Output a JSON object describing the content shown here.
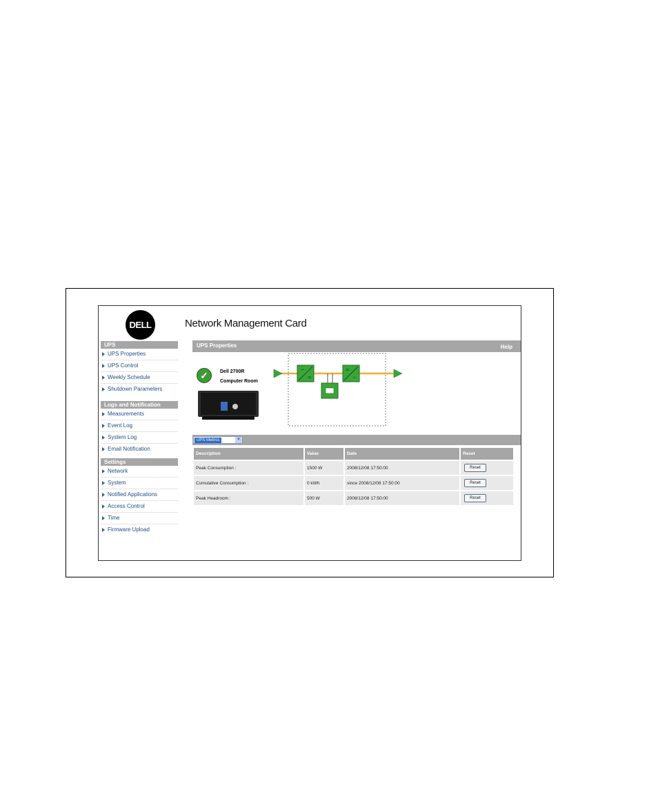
{
  "app": {
    "logo_text": "DELL",
    "title": "Network Management Card"
  },
  "sidebar": {
    "sections": [
      {
        "title": "UPS",
        "items": [
          "UPS Properties",
          "UPS Control",
          "Weekly Schedule",
          "Shutdown Parameters"
        ]
      },
      {
        "title": "Logs and Notification",
        "items": [
          "Measurements",
          "Event Log",
          "System Log",
          "Email Notification"
        ]
      },
      {
        "title": "Settings",
        "items": [
          "Network",
          "System",
          "Notified Applications",
          "Access Control",
          "Time",
          "Firmware Upload"
        ]
      }
    ]
  },
  "main": {
    "header": "UPS Properties",
    "help": "Help",
    "ups_model": "Dell 2700R",
    "ups_location": "Computer Room",
    "status_icon": "check-icon",
    "metrics_select": "UPS Metrics",
    "table": {
      "headers": [
        "Description",
        "Value",
        "Date",
        "Reset"
      ],
      "rows": [
        [
          "Peak Consumption :",
          "1500 W",
          "2008/12/08 17:50:00",
          "Reset"
        ],
        [
          "Cumulative Consumption :",
          "0 kWh",
          "since 2008/12/08 17:50:00",
          "Reset"
        ],
        [
          "Peak Headroom :",
          "500 W",
          "2008/12/08 17:50:00",
          "Reset"
        ]
      ]
    }
  },
  "colors": {
    "header_gray": "#a6a6a6",
    "link_blue": "#1f4e86",
    "flow_green": "#3aa63a",
    "flow_line": "#e8b030"
  }
}
